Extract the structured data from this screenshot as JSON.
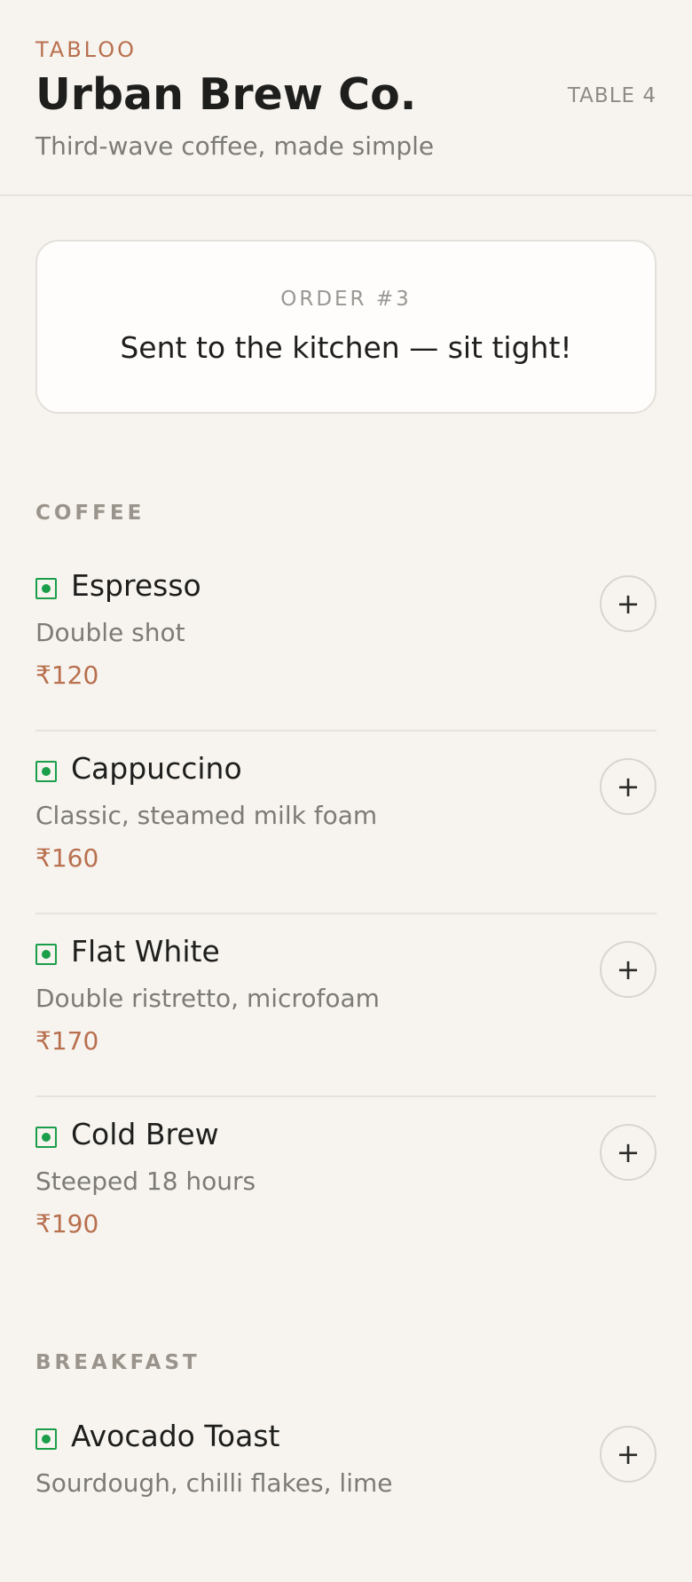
{
  "header": {
    "brand": "TABLOO",
    "title": "Urban Brew Co.",
    "tagline": "Third-wave coffee, made simple",
    "table": "TABLE 4"
  },
  "order": {
    "number": "ORDER #3",
    "status": "Sent to the kitchen — sit tight!"
  },
  "sections": [
    {
      "title": "COFFEE",
      "items": [
        {
          "name": "Espresso",
          "description": "Double shot",
          "price": "₹120",
          "add_label": "+"
        },
        {
          "name": "Cappuccino",
          "description": "Classic, steamed milk foam",
          "price": "₹160",
          "add_label": "+"
        },
        {
          "name": "Flat White",
          "description": "Double ristretto, microfoam",
          "price": "₹170",
          "add_label": "+"
        },
        {
          "name": "Cold Brew",
          "description": "Steeped 18 hours",
          "price": "₹190",
          "add_label": "+"
        }
      ]
    },
    {
      "title": "BREAKFAST",
      "items": [
        {
          "name": "Avocado Toast",
          "description": "Sourdough, chilli flakes, lime",
          "price": "",
          "add_label": "+"
        }
      ]
    }
  ],
  "colors": {
    "accent": "#b8704f",
    "veg_indicator": "#1a9e4a",
    "background": "#f7f4ef"
  },
  "icons": {
    "veg": "veg-indicator-icon",
    "add": "plus-icon"
  }
}
